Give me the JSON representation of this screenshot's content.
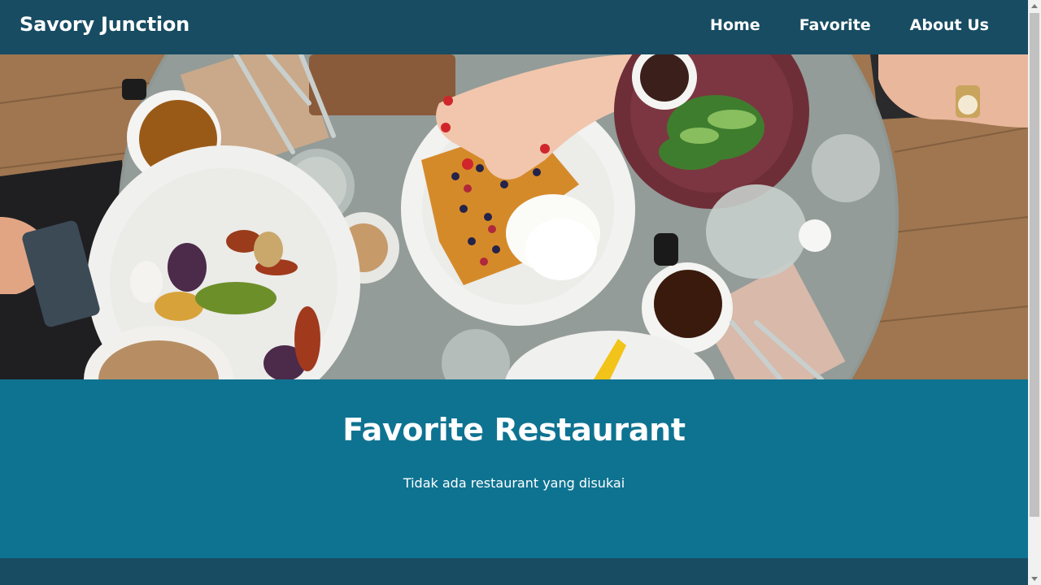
{
  "header": {
    "brand": "Savory Junction",
    "nav": [
      {
        "label": "Home"
      },
      {
        "label": "Favorite"
      },
      {
        "label": "About Us"
      }
    ]
  },
  "hero": {
    "image_description_icon": "food-table-hero-image"
  },
  "main": {
    "title": "Favorite Restaurant",
    "empty_message": "Tidak ada restaurant yang disukai"
  },
  "colors": {
    "header_bg": "#174c62",
    "main_bg": "#0e7391",
    "footer_bg": "#174c62",
    "text": "#ffffff"
  }
}
